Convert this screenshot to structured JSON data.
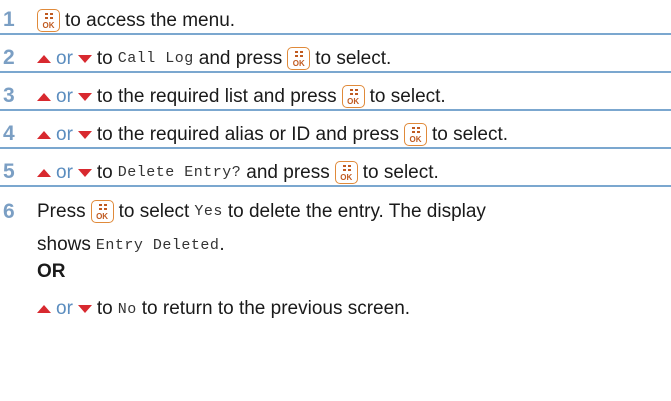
{
  "steps": [
    {
      "num": "1",
      "text_a": "to access the menu."
    },
    {
      "num": "2",
      "or": "or",
      "to": "to",
      "mono": "Call Log",
      "text_b": "and press",
      "text_c": "to select."
    },
    {
      "num": "3",
      "or": "or",
      "text_a": "to the required list and press",
      "text_c": "to select."
    },
    {
      "num": "4",
      "or": "or",
      "text_a": "to the required alias or ID and press",
      "text_c": "to select."
    },
    {
      "num": "5",
      "or": "or",
      "to": "to",
      "mono": "Delete Entry?",
      "text_b": "and press",
      "text_c": "to select."
    }
  ],
  "step6": {
    "num": "6",
    "press": "Press",
    "select": "to select",
    "yes": "Yes",
    "rest": "to delete the entry. The display",
    "shows": "shows",
    "entry_deleted": "Entry Deleted",
    "period": ".",
    "or_label": "OR",
    "or2": "or",
    "to": "to",
    "no": "No",
    "return_text": "to return to the previous screen."
  },
  "icons": {
    "ok": "ok-menu-key-icon",
    "up": "up-arrow-icon",
    "down": "down-arrow-icon"
  },
  "colors": {
    "step_number": "#7b9fc4",
    "or_text": "#5b8dbf",
    "arrow": "#d8292f",
    "key_border": "#e08a3a",
    "rule": "#7ba7cf"
  }
}
